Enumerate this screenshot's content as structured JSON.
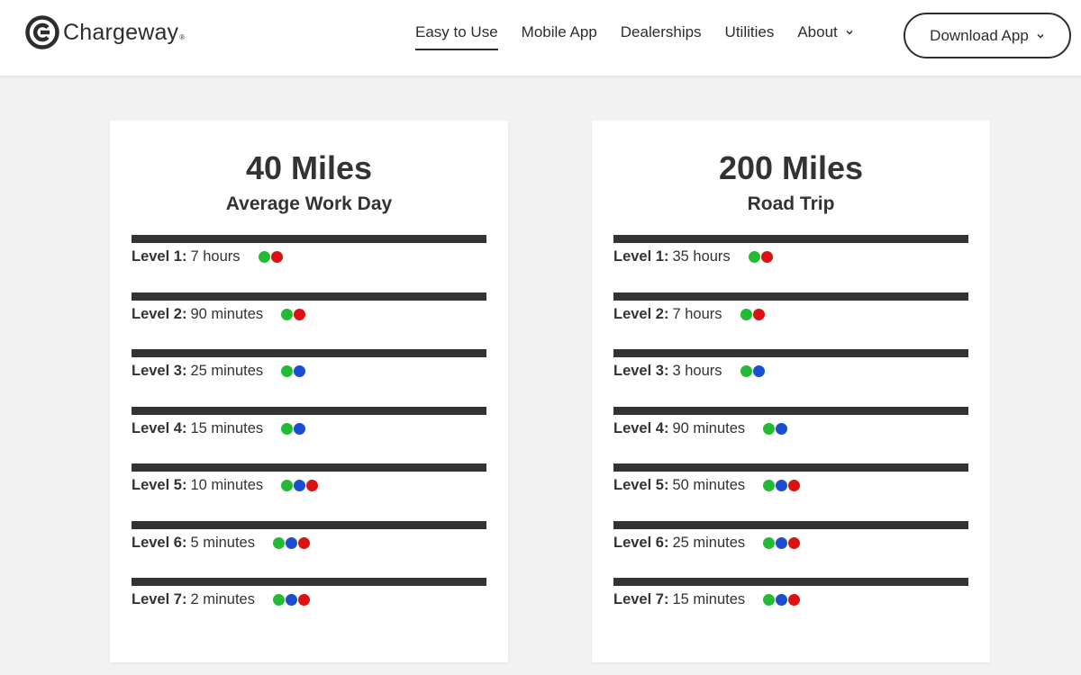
{
  "brand": {
    "name": "Chargeway",
    "trademark": "®"
  },
  "nav": {
    "items": [
      {
        "label": "Easy to Use",
        "active": true,
        "dropdown": false
      },
      {
        "label": "Mobile App",
        "active": false,
        "dropdown": false
      },
      {
        "label": "Dealerships",
        "active": false,
        "dropdown": false
      },
      {
        "label": "Utilities",
        "active": false,
        "dropdown": false
      },
      {
        "label": "About",
        "active": false,
        "dropdown": true
      }
    ],
    "download_label": "Download App"
  },
  "colors": {
    "green": "#22bb33",
    "blue": "#1a4fd0",
    "red": "#dd1111"
  },
  "cards": [
    {
      "title": "40 Miles",
      "subtitle": "Average Work Day",
      "levels": [
        {
          "label": "Level 1:",
          "time": "7 hours",
          "dots": [
            "green",
            "red"
          ]
        },
        {
          "label": "Level 2:",
          "time": "90 minutes",
          "dots": [
            "green",
            "red"
          ]
        },
        {
          "label": "Level 3:",
          "time": "25 minutes",
          "dots": [
            "green",
            "blue"
          ]
        },
        {
          "label": "Level 4:",
          "time": "15 minutes",
          "dots": [
            "green",
            "blue"
          ]
        },
        {
          "label": "Level 5:",
          "time": "10 minutes",
          "dots": [
            "green",
            "blue",
            "red"
          ]
        },
        {
          "label": "Level 6:",
          "time": "5 minutes",
          "dots": [
            "green",
            "blue",
            "red"
          ]
        },
        {
          "label": "Level 7:",
          "time": "2 minutes",
          "dots": [
            "green",
            "blue",
            "red"
          ]
        }
      ]
    },
    {
      "title": "200 Miles",
      "subtitle": "Road Trip",
      "levels": [
        {
          "label": "Level 1:",
          "time": "35 hours",
          "dots": [
            "green",
            "red"
          ]
        },
        {
          "label": "Level 2:",
          "time": "7 hours",
          "dots": [
            "green",
            "red"
          ]
        },
        {
          "label": "Level 3:",
          "time": "3 hours",
          "dots": [
            "green",
            "blue"
          ]
        },
        {
          "label": "Level 4:",
          "time": "90 minutes",
          "dots": [
            "green",
            "blue"
          ]
        },
        {
          "label": "Level 5:",
          "time": "50 minutes",
          "dots": [
            "green",
            "blue",
            "red"
          ]
        },
        {
          "label": "Level 6:",
          "time": "25 minutes",
          "dots": [
            "green",
            "blue",
            "red"
          ]
        },
        {
          "label": "Level 7:",
          "time": "15 minutes",
          "dots": [
            "green",
            "blue",
            "red"
          ]
        }
      ]
    }
  ]
}
